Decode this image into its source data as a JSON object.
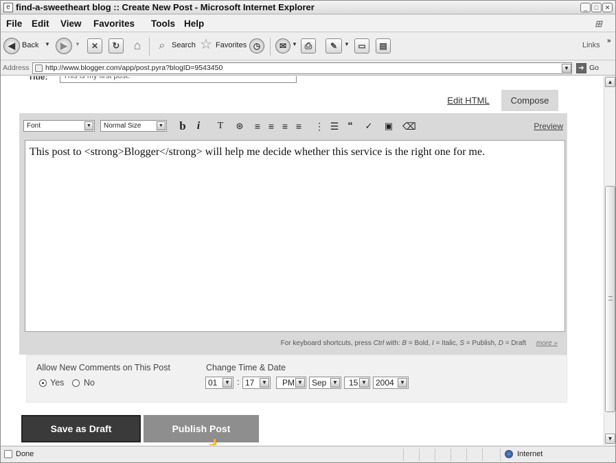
{
  "window": {
    "title": "find-a-sweetheart blog :: Create New Post - Microsoft Internet Explorer"
  },
  "menu": [
    "File",
    "Edit",
    "View",
    "Favorites",
    "Tools",
    "Help"
  ],
  "toolbar": {
    "back_label": "Back",
    "search_label": "Search",
    "favorites_label": "Favorites",
    "links_label": "Links"
  },
  "address": {
    "label": "Address",
    "url": "http://www.blogger.com/app/post.pyra?blogID=9543450",
    "go_label": "Go"
  },
  "post": {
    "title_label": "Title:",
    "title_value": "This is my first post."
  },
  "tabs": {
    "edit_html": "Edit HTML",
    "compose": "Compose"
  },
  "format": {
    "font": "Font",
    "size": "Normal Size",
    "preview": "Preview"
  },
  "editor": {
    "body": "This post to <strong>Blogger</strong> will help me decide whether this service is the right one for me."
  },
  "shortcuts": {
    "prefix": "For keyboard shortcuts, press",
    "ctrl": "Ctrl",
    "mid": "with:",
    "b_key": "B",
    "b_text": "= Bold,",
    "i_key": "I",
    "i_text": "= Italic,",
    "s_key": "S",
    "s_text": "= Publish,",
    "d_key": "D",
    "d_text": "= Draft",
    "more": "more »"
  },
  "comments": {
    "label": "Allow New Comments on This Post",
    "yes": "Yes",
    "no": "No",
    "selected": "Yes"
  },
  "datetime": {
    "label": "Change Time & Date",
    "hour": "01",
    "sep": ":",
    "minute": "17",
    "ampm": "PM",
    "month": "Sep",
    "day": "15",
    "year": "2004"
  },
  "buttons": {
    "save_draft": "Save as Draft",
    "publish": "Publish Post"
  },
  "status": {
    "text": "Done",
    "zone": "Internet"
  }
}
